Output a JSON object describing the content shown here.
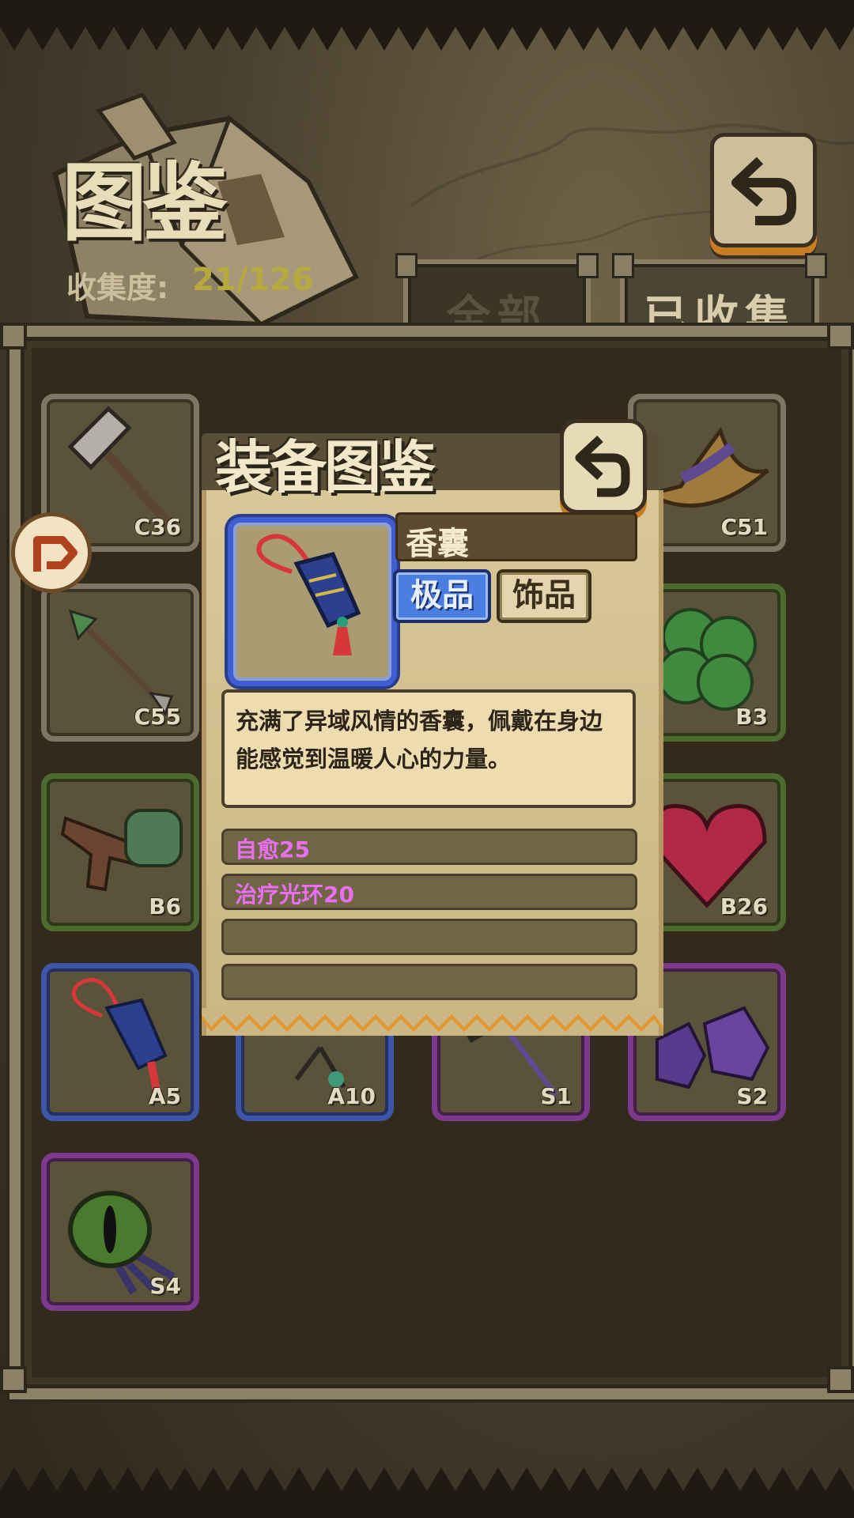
{
  "header": {
    "title": "图鉴",
    "collection_label": "收集度:",
    "collection_value": "21/126",
    "back_icon": "return-arrow-icon"
  },
  "tabs": [
    {
      "label": "全部",
      "active": false
    },
    {
      "label": "已收集",
      "active": true
    }
  ],
  "grid": {
    "items": [
      {
        "code": "C36",
        "rarity": "common",
        "icon": "hammer-icon"
      },
      {
        "code": "C51",
        "rarity": "common",
        "icon": "witch-hat-icon"
      },
      {
        "code": "C55",
        "rarity": "common",
        "icon": "arrow-icon"
      },
      {
        "code": "B3",
        "rarity": "green",
        "icon": "clover-icon"
      },
      {
        "code": "B6",
        "rarity": "green",
        "icon": "water-gun-icon"
      },
      {
        "code": "B26",
        "rarity": "green",
        "icon": "heart-gem-icon"
      },
      {
        "code": "A5",
        "rarity": "blue",
        "icon": "sachet-icon"
      },
      {
        "code": "A10",
        "rarity": "blue",
        "icon": "herb-icon"
      },
      {
        "code": "S1",
        "rarity": "purple",
        "icon": "staff-icon"
      },
      {
        "code": "S2",
        "rarity": "purple",
        "icon": "crystal-boots-icon"
      },
      {
        "code": "S4",
        "rarity": "purple",
        "icon": "eye-amulet-icon"
      }
    ]
  },
  "dialog": {
    "title": "装备图鉴",
    "close_icon": "return-arrow-icon",
    "item_name": "香囊",
    "quality_badge": "极品",
    "type_badge": "饰品",
    "description": "充满了异域风情的香囊，佩戴在身边能感觉到温暖人心的力量。",
    "attributes": [
      "自愈25",
      "治疗光环20",
      "",
      ""
    ],
    "colors": {
      "quality": "#4a7ee0",
      "attribute_text": "#ea6ff0"
    }
  }
}
